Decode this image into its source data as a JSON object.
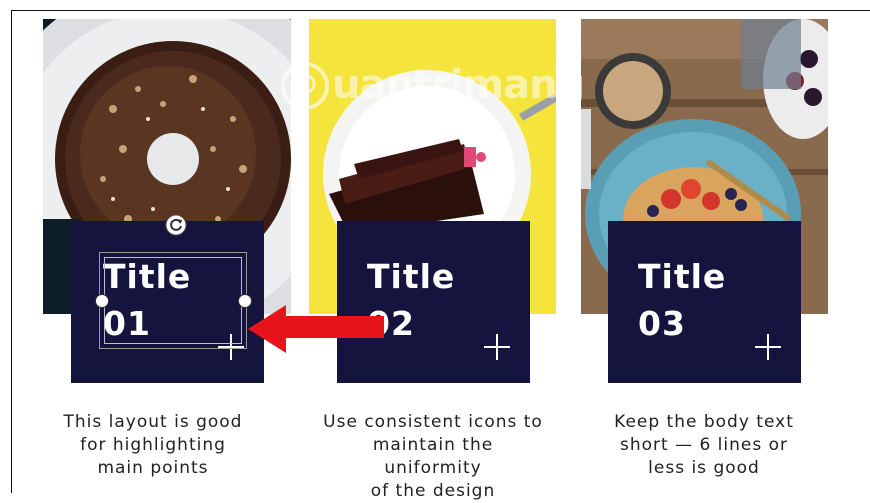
{
  "watermark": {
    "text": "uantrimang"
  },
  "cards": [
    {
      "title": "Title\n01",
      "caption": "This layout is good\nfor highlighting\nmain points"
    },
    {
      "title": "Title\n02",
      "caption": "Use consistent icons to\nmaintain the uniformity\nof the design"
    },
    {
      "title": "Title\n03",
      "caption": "Keep the body text\nshort — 6 lines or\nless is good"
    }
  ],
  "colors": {
    "card_bg": "#14143f",
    "arrow": "#e8141c"
  },
  "icons": {
    "plus": "plus-icon",
    "rotate": "rotate-handle-icon"
  }
}
